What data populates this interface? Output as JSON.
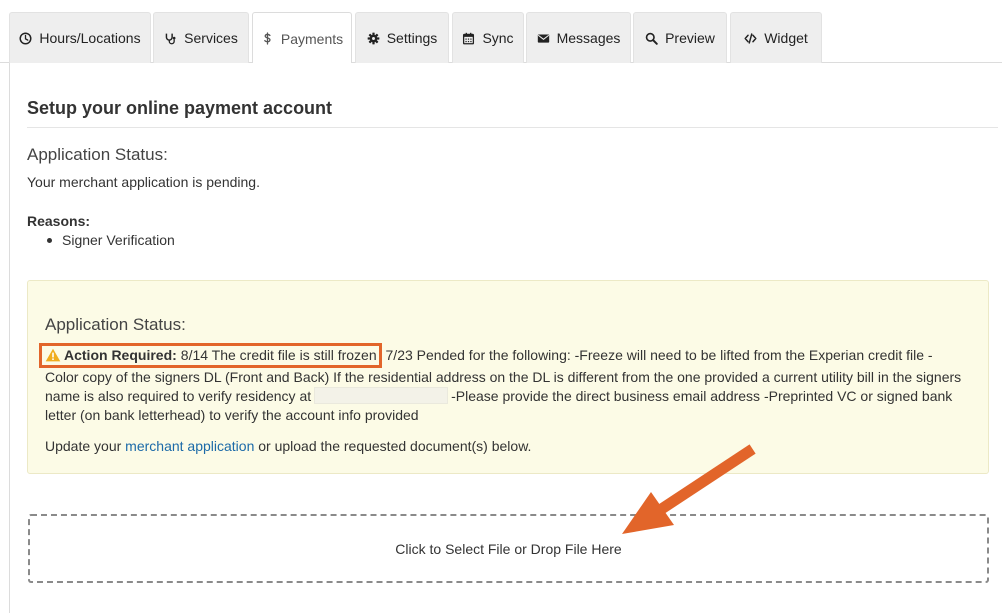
{
  "tabs": [
    {
      "label": "Hours/Locations",
      "icon": "clock-icon",
      "active": false
    },
    {
      "label": "Services",
      "icon": "stethoscope-icon",
      "active": false
    },
    {
      "label": "Payments",
      "icon": "dollar-icon",
      "active": true
    },
    {
      "label": "Settings",
      "icon": "gear-icon",
      "active": false
    },
    {
      "label": "Sync",
      "icon": "calendar-icon",
      "active": false
    },
    {
      "label": "Messages",
      "icon": "envelope-icon",
      "active": false
    },
    {
      "label": "Preview",
      "icon": "search-icon",
      "active": false
    },
    {
      "label": "Widget",
      "icon": "code-icon",
      "active": false
    }
  ],
  "page": {
    "title": "Setup your online payment account",
    "status_heading": "Application Status:",
    "status_text": "Your merchant application is pending.",
    "reasons_label": "Reasons:",
    "reasons": [
      "Signer Verification"
    ]
  },
  "alert": {
    "heading": "Application Status:",
    "action_label": "Action Required:",
    "highlighted_note": "8/14 The credit file is still frozen",
    "message_part1": " 7/23 Pended for the following: -Freeze will need to be lifted from the Experian credit file -Color copy of the signers DL (Front and Back) If the residential address on the DL is different from the one provided a current utility bill in the signers name is also required to verify residency at",
    "message_part2": "-Please provide the direct business email address -Preprinted VC or signed bank letter (on bank letterhead) to verify the account info provided",
    "footer_prefix": "Update your ",
    "footer_link": "merchant application",
    "footer_suffix": " or upload the requested document(s) below."
  },
  "upload": {
    "label": "Click to Select File or Drop File Here"
  },
  "colors": {
    "accent": "#e2652a",
    "link": "#1c6aa8",
    "alert_background": "#fcfbe6",
    "warning": "#f0ad1e"
  }
}
